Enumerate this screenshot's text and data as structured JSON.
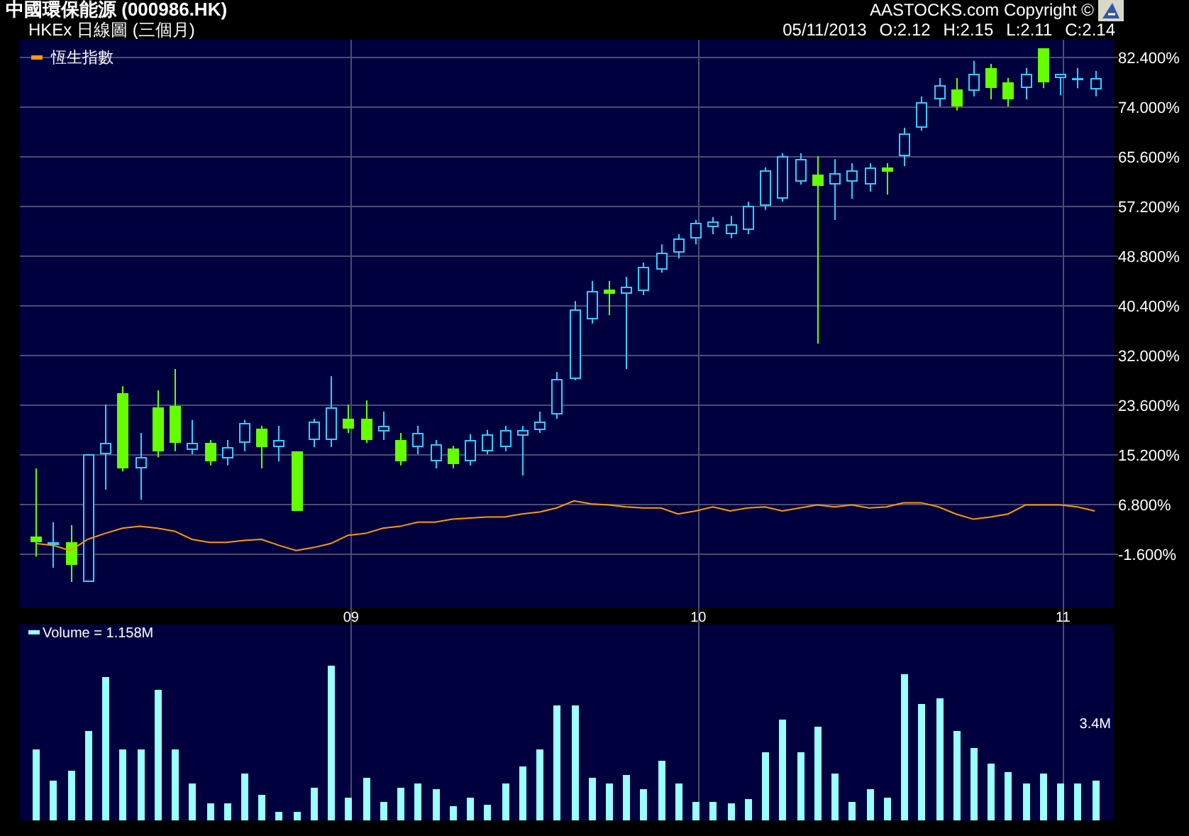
{
  "header": {
    "title": "中國環保能源 (000986.HK)",
    "subtitle": "HKEx 日線圖 (三個月)",
    "copyright": "AASTOCKS.com Copyright ©",
    "date": "05/11/2013",
    "ohlc": [
      "O:2.12",
      "H:2.15",
      "L:2.11",
      "C:2.14"
    ]
  },
  "price_chart": {
    "chart_data": {
      "type": "candlestick",
      "grid": true,
      "ylim": [
        -10.72,
        85.28
      ],
      "categories": [
        null,
        null,
        null,
        null,
        null,
        null,
        null,
        null,
        null,
        null,
        null,
        null,
        null,
        null,
        null,
        null,
        null,
        null,
        "09",
        null,
        null,
        null,
        null,
        null,
        null,
        null,
        null,
        null,
        null,
        null,
        null,
        null,
        null,
        null,
        null,
        null,
        null,
        null,
        "10",
        null,
        null,
        null,
        null,
        null,
        null,
        null,
        null,
        null,
        null,
        null,
        null,
        null,
        null,
        null,
        null,
        null,
        null,
        null,
        null,
        "11",
        null,
        null
      ],
      "yticks": [
        {
          "value": 82.4,
          "label": "82.400%"
        },
        {
          "value": 74,
          "label": "74.000%"
        },
        {
          "value": 65.6,
          "label": "65.600%"
        },
        {
          "value": 57.2,
          "label": "57.200%"
        },
        {
          "value": 48.8,
          "label": "48.800%"
        },
        {
          "value": 40.4,
          "label": "40.400%"
        },
        {
          "value": 32,
          "label": "32.000%"
        },
        {
          "value": 23.6,
          "label": "23.600%"
        },
        {
          "value": 15.2,
          "label": "15.200%"
        },
        {
          "value": 6.8,
          "label": "6.800%"
        },
        {
          "value": -1.6,
          "label": "-1.600%"
        }
      ],
      "ohlc": [
        [
          1.3,
          12.8,
          -2.1,
          0.3
        ],
        [
          -0.2,
          3.7,
          -4.0,
          0.3
        ],
        [
          0.3,
          3.2,
          -6.4,
          -3.5
        ],
        [
          -6.4,
          15.2,
          -6.4,
          15.2
        ],
        [
          15.2,
          23.6,
          9.2,
          17.1
        ],
        [
          25.5,
          26.7,
          12.3,
          12.8
        ],
        [
          12.8,
          18.8,
          7.5,
          14.7
        ],
        [
          23.1,
          26.0,
          14.7,
          15.7
        ],
        [
          23.4,
          29.6,
          15.7,
          17.1
        ],
        [
          15.9,
          21.0,
          15.2,
          17.1
        ],
        [
          17.1,
          17.6,
          13.3,
          14.0
        ],
        [
          14.5,
          17.6,
          13.3,
          16.4
        ],
        [
          17.1,
          21.0,
          15.7,
          20.5
        ],
        [
          19.5,
          20.0,
          12.8,
          16.4
        ],
        [
          16.4,
          20.0,
          14.0,
          17.6
        ],
        [
          15.7,
          15.7,
          5.6,
          5.6
        ],
        [
          17.6,
          21.2,
          16.4,
          20.7
        ],
        [
          17.6,
          28.4,
          16.4,
          23.1
        ],
        [
          21.2,
          23.6,
          18.8,
          19.5
        ],
        [
          21.2,
          24.3,
          17.1,
          17.6
        ],
        [
          19.0,
          22.4,
          17.6,
          20.0
        ],
        [
          17.6,
          18.8,
          13.3,
          14.0
        ],
        [
          16.4,
          20.0,
          15.2,
          18.8
        ],
        [
          14.0,
          17.6,
          12.8,
          16.9
        ],
        [
          16.2,
          16.6,
          12.8,
          13.5
        ],
        [
          14.0,
          18.6,
          13.3,
          17.6
        ],
        [
          15.7,
          19.3,
          15.2,
          18.6
        ],
        [
          16.4,
          20.0,
          15.7,
          19.3
        ],
        [
          18.3,
          20.0,
          11.6,
          19.3
        ],
        [
          19.3,
          22.4,
          18.8,
          20.7
        ],
        [
          21.9,
          29.1,
          21.2,
          27.9
        ],
        [
          27.9,
          41.1,
          27.7,
          39.7
        ],
        [
          38.0,
          44.5,
          37.3,
          42.8
        ],
        [
          43.0,
          44.5,
          38.7,
          42.3
        ],
        [
          42.3,
          45.2,
          29.6,
          43.5
        ],
        [
          42.8,
          47.6,
          42.1,
          46.9
        ],
        [
          46.4,
          50.7,
          45.9,
          49.3
        ],
        [
          49.3,
          52.4,
          48.3,
          51.7
        ],
        [
          51.7,
          54.8,
          50.7,
          54.3
        ],
        [
          53.6,
          55.3,
          52.4,
          54.6
        ],
        [
          52.4,
          55.5,
          51.7,
          54.1
        ],
        [
          53.1,
          57.9,
          52.4,
          57.2
        ],
        [
          57.2,
          63.7,
          56.5,
          63.2
        ],
        [
          58.4,
          66.1,
          57.9,
          65.6
        ],
        [
          61.3,
          66.1,
          60.8,
          65.1
        ],
        [
          62.5,
          65.6,
          33.9,
          60.6
        ],
        [
          60.8,
          65.1,
          54.8,
          62.7
        ],
        [
          61.3,
          64.4,
          58.4,
          63.2
        ],
        [
          60.8,
          64.4,
          59.6,
          63.7
        ],
        [
          63.7,
          64.4,
          59.1,
          63.0
        ],
        [
          65.6,
          70.4,
          63.9,
          69.4
        ],
        [
          70.4,
          75.7,
          69.9,
          74.7
        ],
        [
          75.2,
          78.8,
          74.0,
          77.6
        ],
        [
          76.9,
          78.8,
          73.3,
          74.0
        ],
        [
          76.6,
          81.7,
          75.7,
          79.5
        ],
        [
          80.5,
          81.2,
          75.2,
          77.1
        ],
        [
          78.1,
          78.8,
          74.0,
          75.2
        ],
        [
          77.1,
          80.5,
          75.2,
          79.5
        ],
        [
          83.8,
          83.8,
          77.1,
          78.1
        ],
        [
          78.8,
          79.5,
          75.9,
          79.5
        ],
        [
          78.6,
          80.5,
          77.1,
          78.8
        ],
        [
          76.9,
          80.0,
          75.7,
          78.8
        ]
      ],
      "series": [
        {
          "type": "line",
          "name": "恆生指數",
          "color": "#ff9900",
          "values": [
            0.1,
            -0.2,
            -1.1,
            0.8,
            1.8,
            2.7,
            3.0,
            2.7,
            2.2,
            0.8,
            0.3,
            0.3,
            0.6,
            0.8,
            -0.2,
            -1.1,
            -0.6,
            0.1,
            1.5,
            1.8,
            2.7,
            3.0,
            3.7,
            3.7,
            4.2,
            4.4,
            4.6,
            4.6,
            5.1,
            5.4,
            6.1,
            7.3,
            6.8,
            6.6,
            6.3,
            6.1,
            6.1,
            5.1,
            5.6,
            6.3,
            5.6,
            6.1,
            6.3,
            5.6,
            6.1,
            6.6,
            6.3,
            6.6,
            6.1,
            6.3,
            7.0,
            7.0,
            6.3,
            5.1,
            4.2,
            4.6,
            5.1,
            6.6,
            6.6,
            6.6,
            6.3,
            5.6
          ]
        }
      ]
    }
  },
  "volume_chart": {
    "legend": "Volume = 1.158M",
    "scale_label": "3.4M"
  }
}
